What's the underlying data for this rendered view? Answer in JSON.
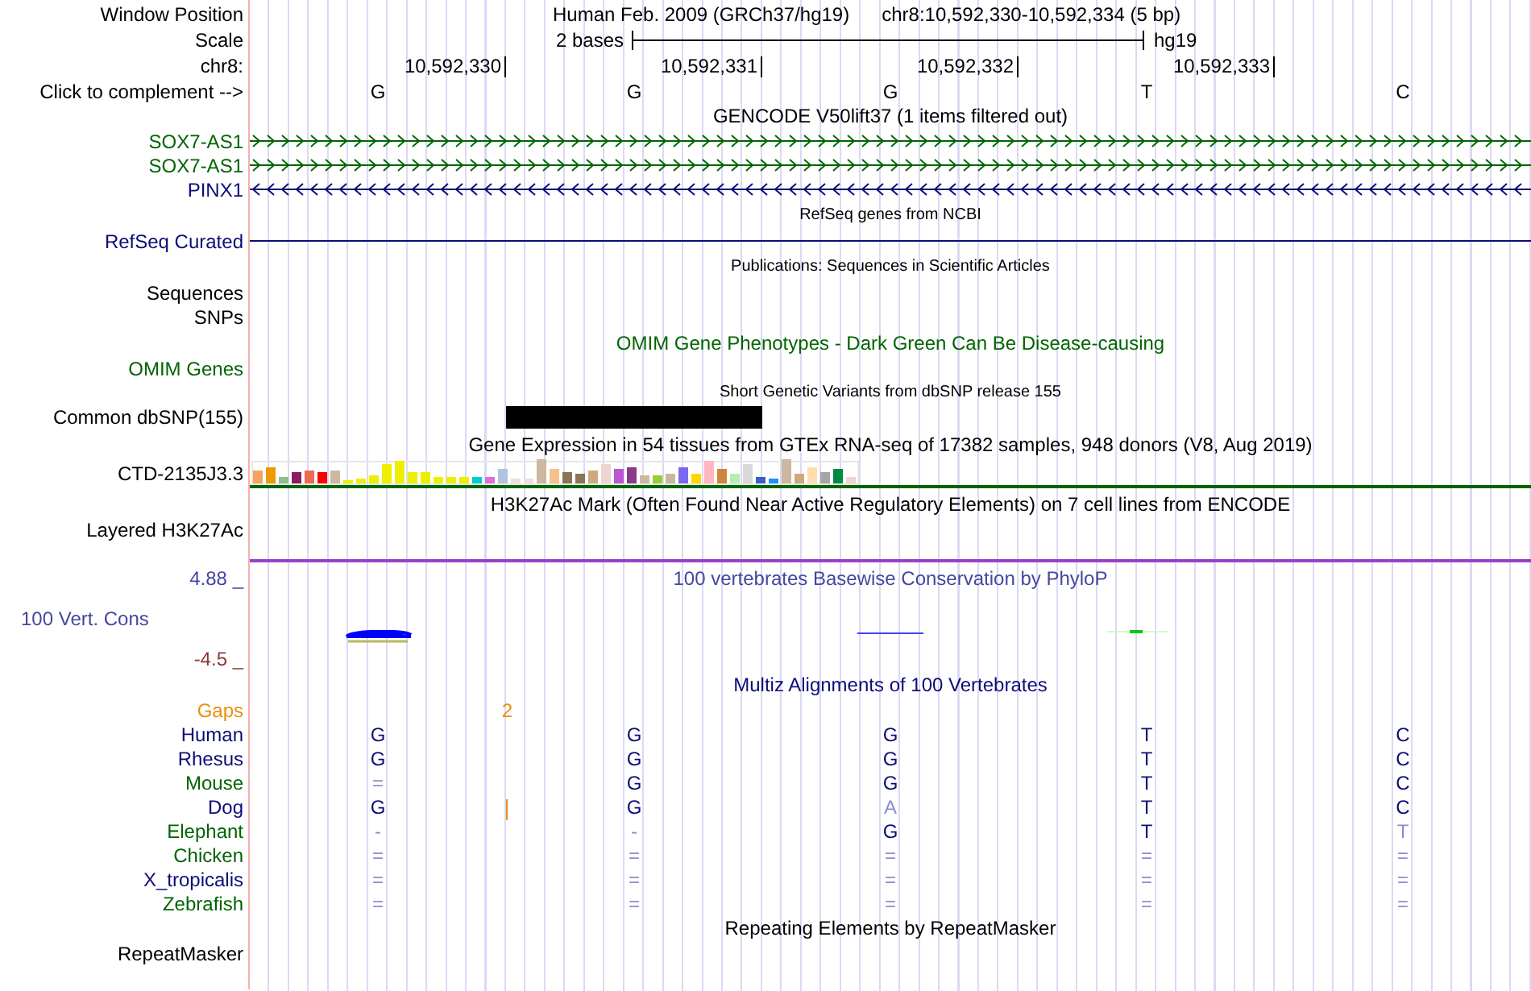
{
  "header": {
    "window_label": "Window Position",
    "assembly": "Human Feb. 2009 (GRCh37/hg19)",
    "location": "chr8:10,592,330-10,592,334 (5 bp)",
    "scale_label": "Scale",
    "scale_span": "2 bases",
    "scale_assembly": "hg19",
    "chrom_label": "chr8:",
    "positions": [
      "10,592,330",
      "10,592,331",
      "10,592,332",
      "10,592,333"
    ],
    "complement_label": "Click to complement -->",
    "bases": [
      "G",
      "G",
      "G",
      "T",
      "C"
    ]
  },
  "gencode": {
    "title": "GENCODE V50lift37 (1 items filtered out)",
    "genes": [
      {
        "name": "SOX7-AS1",
        "reverse": false,
        "color": "#006400"
      },
      {
        "name": "SOX7-AS1",
        "reverse": false,
        "color": "#006400"
      },
      {
        "name": "PINX1",
        "reverse": true,
        "color": "#0c0c78"
      }
    ]
  },
  "refseq": {
    "title": "RefSeq genes from NCBI",
    "label": "RefSeq Curated"
  },
  "publications": {
    "title": "Publications: Sequences in Scientific Articles",
    "labels": [
      "Sequences",
      "SNPs"
    ]
  },
  "omim": {
    "title": "OMIM Gene Phenotypes - Dark Green Can Be Disease-causing",
    "label": "OMIM Genes"
  },
  "dbsnp": {
    "title": "Short Genetic Variants from dbSNP release 155",
    "label": "Common dbSNP(155)"
  },
  "gtex": {
    "title": "Gene Expression in 54 tissues from GTEx RNA-seq of 17382 samples, 948 donors (V8, Aug 2019)",
    "label": "CTD-2135J3.3"
  },
  "h3k27ac": {
    "title": "H3K27Ac Mark (Often Found Near Active Regulatory Elements) on 7 cell lines from ENCODE",
    "label": "Layered H3K27Ac"
  },
  "phylop": {
    "title": "100 vertebrates Basewise Conservation by PhyloP",
    "label": "100 Vert. Cons",
    "max": "4.88 _",
    "min": "-4.5 _"
  },
  "multiz": {
    "title": "Multiz Alignments of 100 Vertebrates",
    "gaps_label": "Gaps",
    "gap_count": "2",
    "species": [
      {
        "name": "Human",
        "color": "#0c0c78",
        "bases": [
          "G",
          "G",
          "G",
          "T",
          "C"
        ],
        "faded": [
          false,
          false,
          false,
          false,
          false
        ]
      },
      {
        "name": "Rhesus",
        "color": "#0c0c78",
        "bases": [
          "G",
          "G",
          "G",
          "T",
          "C"
        ],
        "faded": [
          false,
          false,
          false,
          false,
          false
        ]
      },
      {
        "name": "Mouse",
        "color": "#006400",
        "bases": [
          "=",
          "G",
          "G",
          "T",
          "C"
        ],
        "faded": [
          true,
          false,
          false,
          false,
          false
        ]
      },
      {
        "name": "Dog",
        "color": "#0c0c78",
        "insertion": true,
        "bases": [
          "G",
          "G",
          "A",
          "T",
          "C"
        ],
        "faded": [
          false,
          false,
          true,
          false,
          false
        ]
      },
      {
        "name": "Elephant",
        "color": "#006400",
        "bases": [
          "-",
          "-",
          "G",
          "T",
          "T"
        ],
        "faded": [
          true,
          true,
          false,
          false,
          true
        ]
      },
      {
        "name": "Chicken",
        "color": "#006400",
        "bases": [
          "=",
          "=",
          "=",
          "=",
          "="
        ],
        "faded": [
          true,
          true,
          true,
          true,
          true
        ]
      },
      {
        "name": "X_tropicalis",
        "color": "#0c0c78",
        "bases": [
          "=",
          "=",
          "=",
          "=",
          "="
        ],
        "faded": [
          true,
          true,
          true,
          true,
          true
        ]
      },
      {
        "name": "Zebrafish",
        "color": "#006400",
        "bases": [
          "=",
          "=",
          "=",
          "=",
          "="
        ],
        "faded": [
          true,
          true,
          true,
          true,
          true
        ]
      }
    ]
  },
  "repeatmasker": {
    "title": "Repeating Elements by RepeatMasker",
    "label": "RepeatMasker"
  }
}
